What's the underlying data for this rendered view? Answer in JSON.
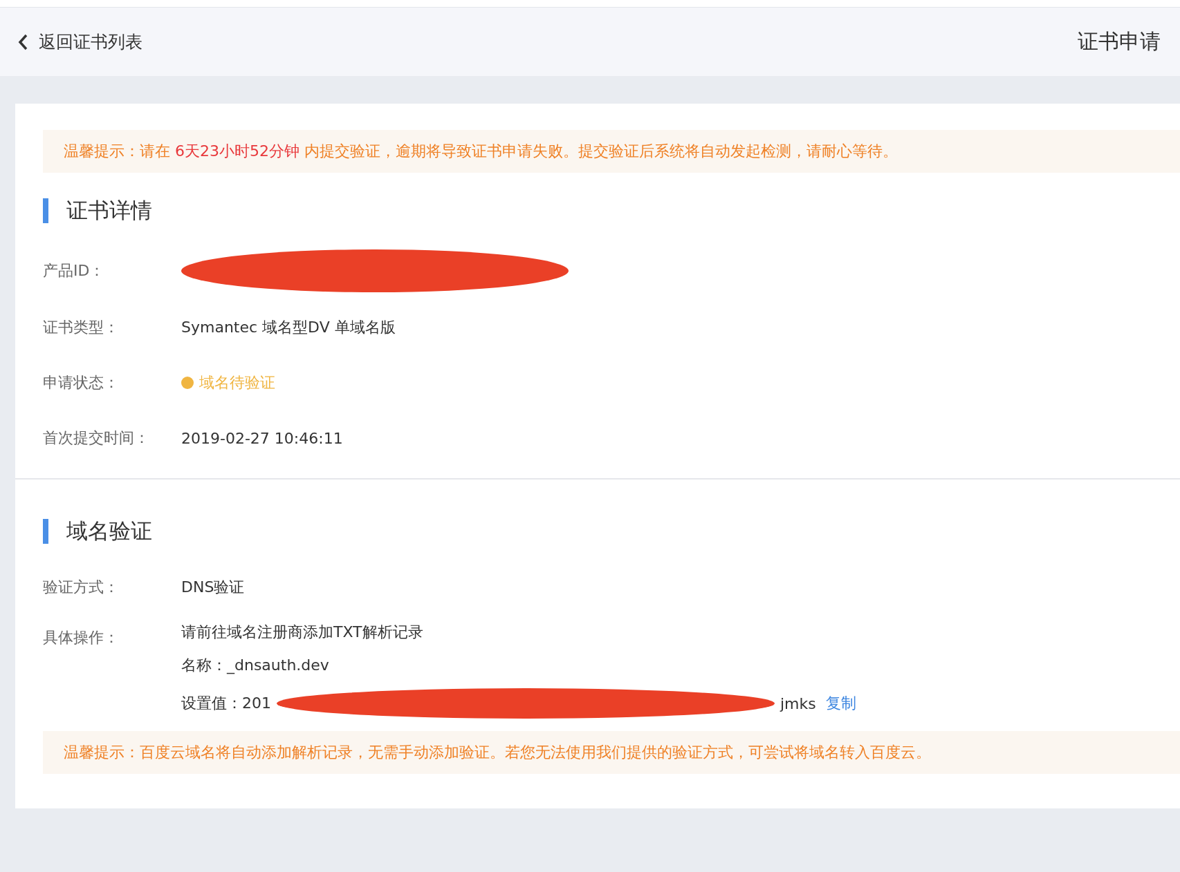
{
  "header": {
    "back_label": "返回证书列表",
    "title": "证书申请"
  },
  "top_notice": {
    "parts": [
      {
        "text": "温馨提示：请在 ",
        "kind": "normal"
      },
      {
        "text": "6天23小时52分钟",
        "kind": "highlight"
      },
      {
        "text": " 内提交验证，逾期将导致证书申请失败。提交验证后系统将自动发起检测，请耐心等待。",
        "kind": "normal"
      }
    ]
  },
  "details": {
    "title": "证书详情",
    "fields": [
      {
        "label": "产品ID：",
        "kind": "redacted"
      },
      {
        "label": "证书类型：",
        "kind": "text",
        "value": "Symantec 域名型DV 单域名版"
      },
      {
        "label": "申请状态：",
        "kind": "status",
        "value": "域名待验证",
        "color": "#f0b541"
      },
      {
        "label": "首次提交时间：",
        "kind": "text",
        "value": "2019-02-27 10:46:11"
      }
    ]
  },
  "verification": {
    "title": "域名验证",
    "method_label": "验证方式：",
    "method": "DNS验证",
    "steps_label": "具体操作：",
    "instruction": "请前往域名注册商添加TXT解析记录",
    "name_line": "名称：_dnsauth.dev",
    "value_prefix": "设置值：201",
    "value_suffix": "jmks",
    "copy_link": "复制"
  },
  "bottom_notice": {
    "text": "温馨提示：百度云域名将自动添加解析记录，无需手动添加验证。若您无法使用我们提供的验证方式，可尝试将域名转入百度云。"
  }
}
